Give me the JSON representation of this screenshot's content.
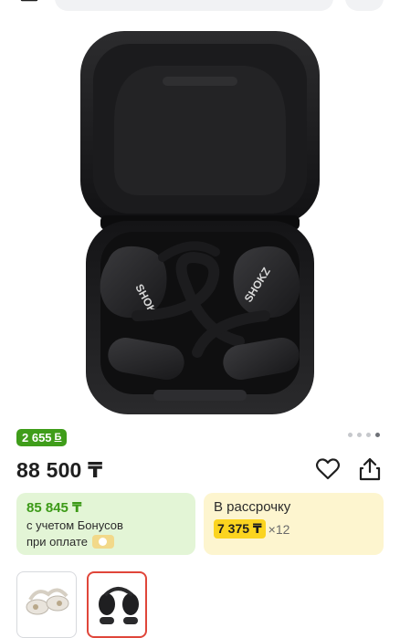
{
  "bonus": {
    "label": "2 655",
    "symbol": "Б"
  },
  "gallery": {
    "active_index": 3,
    "count": 4
  },
  "product": {
    "price": "88 500 ₸"
  },
  "bonus_card": {
    "amount": "85 845 ₸",
    "line1": "с учетом Бонусов",
    "line2": "при оплате"
  },
  "installment_card": {
    "title": "В рассрочку",
    "monthly": "7 375 ₸",
    "times": "×12"
  },
  "colors": {
    "bonus_green": "#3f9d1a",
    "bonus_card_bg": "#e3f5d6",
    "installment_bg": "#fdf5cf",
    "installment_highlight": "#fbd41f",
    "selected_thumb_border": "#e0463a"
  },
  "icons": {
    "back": "arrow-left-icon",
    "favorite": "heart-outline-icon",
    "share": "share-icon",
    "pay": "pay-logo-icon"
  }
}
